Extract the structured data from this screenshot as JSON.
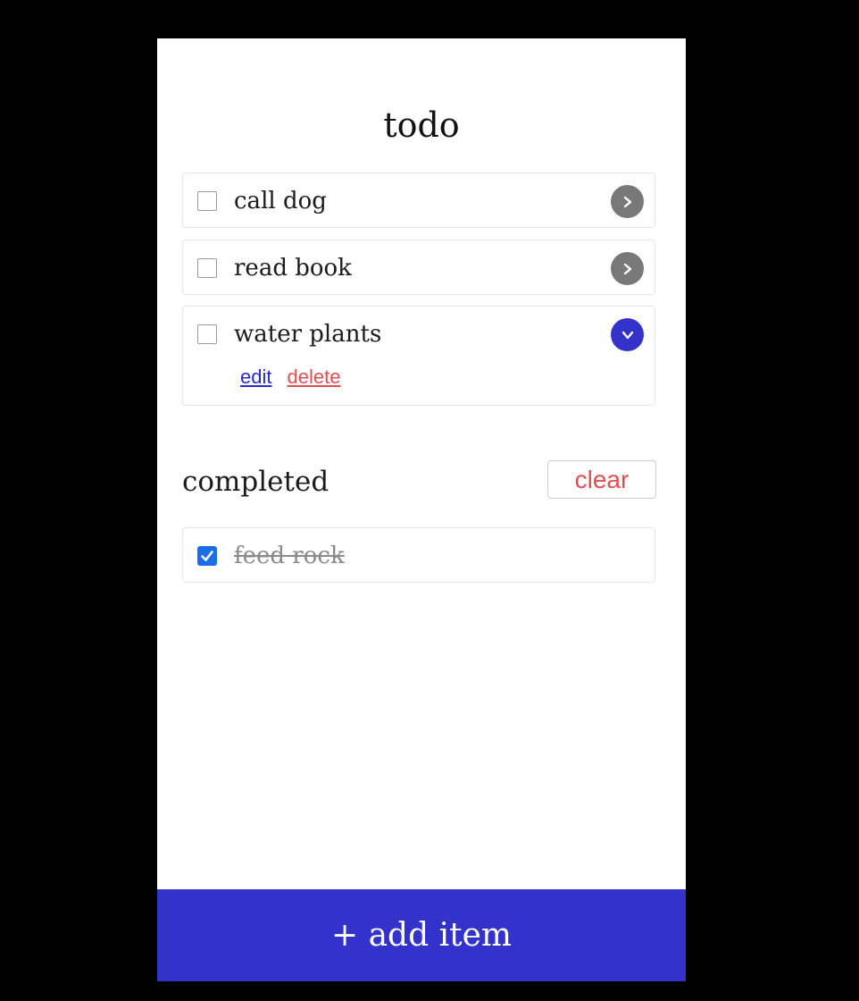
{
  "app": {
    "title": "todo"
  },
  "todos": [
    {
      "label": "call dog",
      "expanded": false,
      "toggle_glyph": ">"
    },
    {
      "label": "read book",
      "expanded": false,
      "toggle_glyph": ">"
    },
    {
      "label": "water plants",
      "expanded": true,
      "toggle_glyph": "v",
      "actions": {
        "edit": "edit",
        "delete": "delete"
      }
    }
  ],
  "completed": {
    "heading": "completed",
    "clear_label": "clear",
    "items": [
      {
        "label": "feed rock",
        "checked": true
      }
    ]
  },
  "footer": {
    "add_label": "+ add item"
  },
  "colors": {
    "accent": "#3333cc",
    "danger": "#e05050",
    "link": "#2a2ac8",
    "checkbox_checked": "#1a6fe8",
    "chevron_collapsed": "#787878"
  },
  "icons": {
    "collapsed_toggle": "chevron-right-icon",
    "expanded_toggle": "chevron-down-icon",
    "checked": "checkmark-icon"
  }
}
